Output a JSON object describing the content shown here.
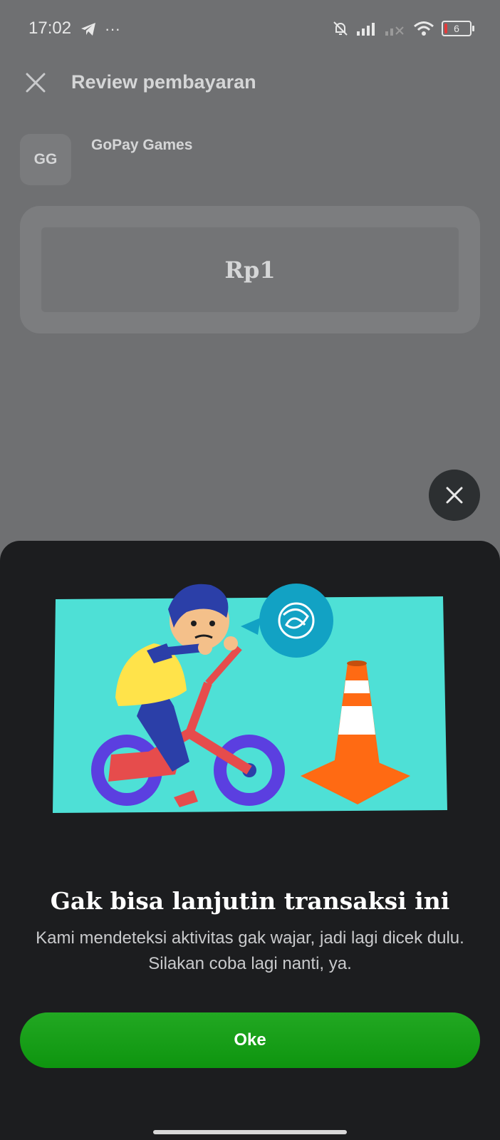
{
  "status_bar": {
    "time": "17:02",
    "more": "···",
    "battery_level": "6"
  },
  "header": {
    "title": "Review pembayaran"
  },
  "merchant": {
    "avatar_initials": "GG",
    "name": "GoPay Games"
  },
  "payment": {
    "amount": "Rp1"
  },
  "sheet": {
    "title": "Gak bisa lanjutin transaksi ini",
    "description": "Kami mendeteksi aktivitas gak wajar, jadi lagi dicek dulu. Silakan coba lagi nanti, ya.",
    "ok_label": "Oke"
  },
  "colors": {
    "primary_green": "#1aa11a",
    "sheet_bg": "#1c1d1f",
    "illustration_bg": "#4ee0d6",
    "cone_orange": "#ff6a13"
  }
}
